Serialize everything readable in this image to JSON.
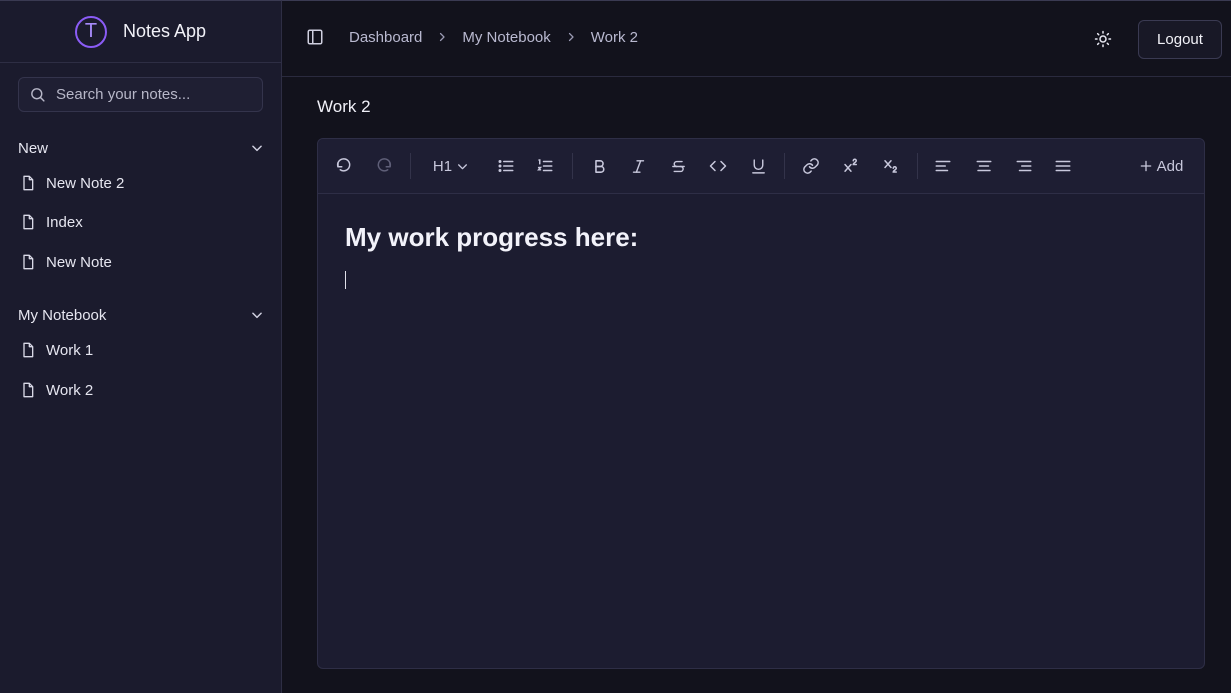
{
  "app": {
    "logo_letter": "T",
    "name": "Notes App"
  },
  "search": {
    "placeholder": "Search your notes..."
  },
  "sidebar": {
    "groups": [
      {
        "label": "New",
        "items": [
          "New Note 2",
          "Index",
          "New Note"
        ]
      },
      {
        "label": "My Notebook",
        "items": [
          "Work 1",
          "Work 2"
        ]
      }
    ]
  },
  "breadcrumb": [
    "Dashboard",
    "My Notebook",
    "Work 2"
  ],
  "header": {
    "logout_label": "Logout"
  },
  "page": {
    "title": "Work 2"
  },
  "toolbar": {
    "heading_label": "H1",
    "add_label": "Add"
  },
  "editor": {
    "heading": "My work progress here:"
  },
  "colors": {
    "accent": "#8b5cf6",
    "background": "#12121c",
    "panel": "#1b1b2d"
  }
}
